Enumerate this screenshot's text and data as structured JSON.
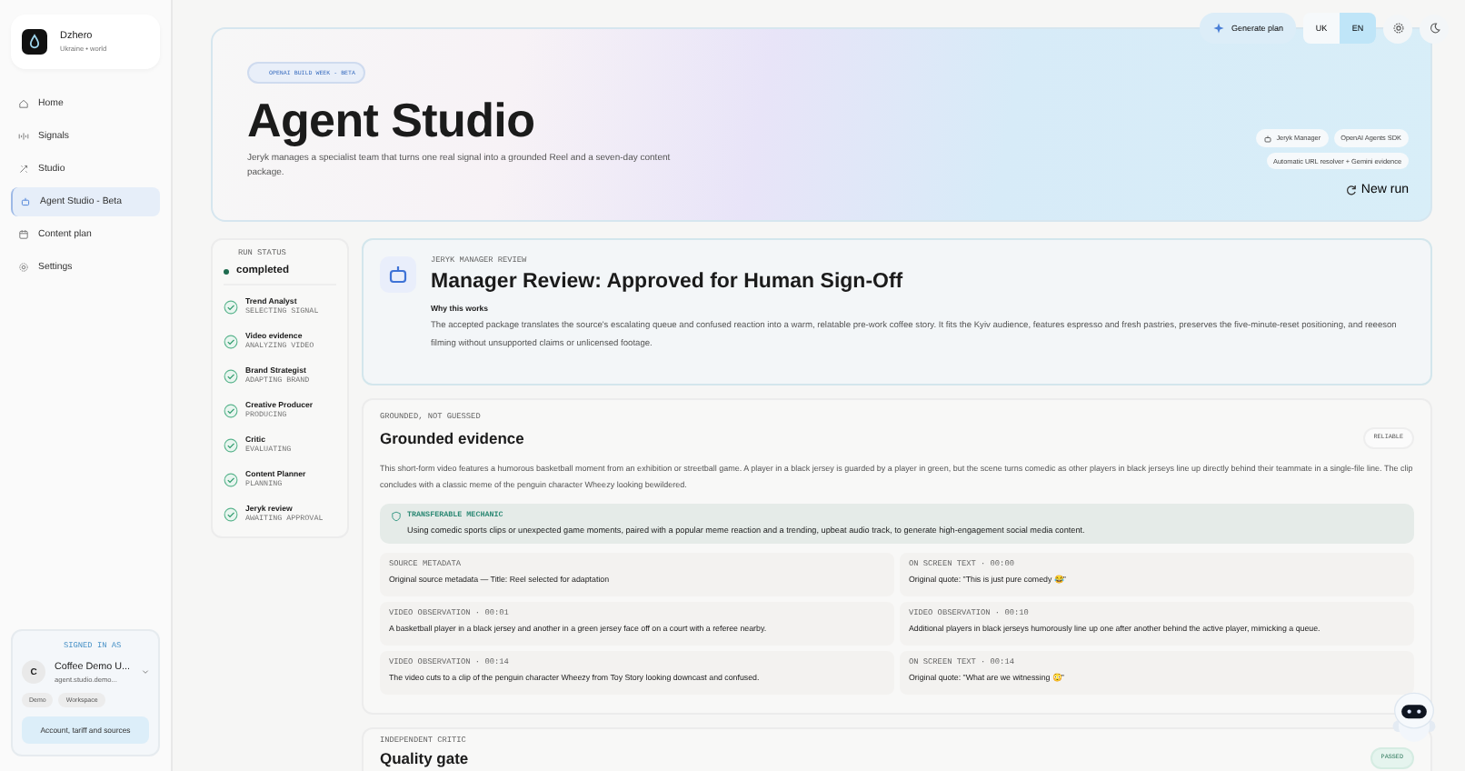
{
  "brand": {
    "name": "Dzhero",
    "subtitle": "Ukraine • world"
  },
  "nav": [
    {
      "label": "Home",
      "selected": false
    },
    {
      "label": "Signals",
      "selected": false
    },
    {
      "label": "Studio",
      "selected": false
    },
    {
      "label": "Agent Studio - Beta",
      "selected": true
    },
    {
      "label": "Content plan",
      "selected": false
    },
    {
      "label": "Settings",
      "selected": false
    }
  ],
  "account": {
    "eyebrow": "SIGNED IN AS",
    "avatar": "C",
    "name": "Coffee Demo U...",
    "email": "agent.studio.demo...",
    "tags": [
      "Demo",
      "Workspace"
    ],
    "button": "Account, tariff and sources"
  },
  "toolbar": {
    "generate": "Generate plan",
    "languages": [
      {
        "label": "UK",
        "selected": false
      },
      {
        "label": "EN",
        "selected": true
      }
    ]
  },
  "hero": {
    "badge": "OPENAI BUILD WEEK - BETA",
    "title": "Agent Studio",
    "description": "Jeryk manages a specialist team that turns one real signal into a grounded Reel and a seven-day content package.",
    "chips": [
      {
        "label": "Jeryk Manager",
        "kind": "agent"
      },
      {
        "label": "OpenAI Agents SDK",
        "kind": "plain"
      },
      {
        "label": "Automatic URL resolver + Gemini evidence",
        "kind": "plain"
      }
    ],
    "new_run": "New run"
  },
  "run_status": {
    "eyebrow": "RUN STATUS",
    "status": "completed",
    "steps": [
      {
        "name": "Trend Analyst",
        "state": "SELECTING SIGNAL",
        "done": true
      },
      {
        "name": "Video evidence",
        "state": "ANALYZING VIDEO",
        "done": true
      },
      {
        "name": "Brand Strategist",
        "state": "ADAPTING BRAND",
        "done": true
      },
      {
        "name": "Creative Producer",
        "state": "PRODUCING",
        "done": true
      },
      {
        "name": "Critic",
        "state": "EVALUATING",
        "done": true
      },
      {
        "name": "Content Planner",
        "state": "PLANNING",
        "done": true
      },
      {
        "name": "Jeryk review",
        "state": "AWAITING APPROVAL",
        "done": true
      }
    ]
  },
  "review": {
    "eyebrow": "JERYK MANAGER REVIEW",
    "title": "Manager Review: Approved for Human Sign-Off",
    "subtitle": "Why this works",
    "body": "The accepted package translates the source's escalating queue and confused reaction into a warm, relatable pre-work coffee story. It fits the Kyiv audience, features espresso and fresh pastries, preserves the five-minute-reset positioning, and reeeson filming without unsupported claims or unlicensed footage."
  },
  "evidence": {
    "eyebrow": "GROUNDED, NOT GUESSED",
    "title": "Grounded evidence",
    "badge": "RELIABLE",
    "summary": "This short-form video features a humorous basketball moment from an exhibition or streetball game. A player in a black jersey is guarded by a player in green, but the scene turns comedic as other players in black jerseys line up directly behind their teammate in a single-file line. The clip concludes with a classic meme of the penguin character Wheezy looking bewildered.",
    "mechanic": {
      "label": "TRANSFERABLE MECHANIC",
      "text": "Using comedic sports clips or unexpected game moments, paired with a popular meme reaction and a trending, upbeat audio track, to generate high-engagement social media content."
    },
    "items": [
      {
        "label": "SOURCE METADATA",
        "text": "Original source metadata — Title: Reel selected for adaptation"
      },
      {
        "label": "ON SCREEN TEXT · 00:00",
        "text": "Original quote: \"This is just pure comedy 😂\""
      },
      {
        "label": "VIDEO OBSERVATION · 00:01",
        "text": "A basketball player in a black jersey and another in a green jersey face off on a court with a referee nearby."
      },
      {
        "label": "VIDEO OBSERVATION · 00:10",
        "text": "Additional players in black jerseys humorously line up one after another behind the active player, mimicking a queue."
      },
      {
        "label": "VIDEO OBSERVATION · 00:14",
        "text": "The video cuts to a clip of the penguin character Wheezy from Toy Story looking downcast and confused."
      },
      {
        "label": "ON SCREEN TEXT · 00:14",
        "text": "Original quote: \"What are we witnessing 😳\""
      }
    ]
  },
  "quality": {
    "eyebrow": "INDEPENDENT CRITIC",
    "title": "Quality gate",
    "badge": "PASSED"
  }
}
